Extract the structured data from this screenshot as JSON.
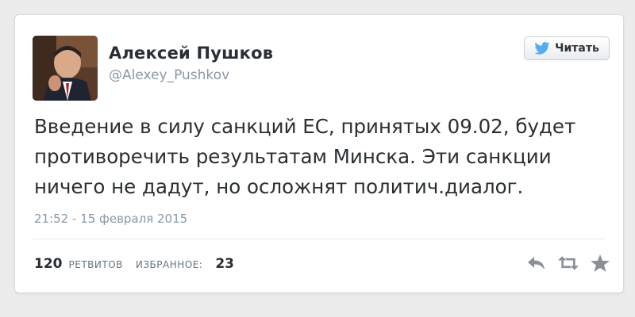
{
  "tweet": {
    "author_name": "Алексей  Пушков",
    "author_handle": "@Alexey_Pushkov",
    "follow_label": "Читать",
    "text": "Введение в силу санкций ЕС, принятых 09.02, будет\nпротиворечить результатам Минска. Эти санкции\nничего не дадут, но осложнят политич.диалог.",
    "timestamp": "21:52 - 15 февраля 2015",
    "retweets_count": "120",
    "retweets_label": "РЕТВИТОВ",
    "favorites_label": "ИЗБРАННОЕ:",
    "favorites_count": "23"
  },
  "icons": {
    "follow": "twitter-bird-icon",
    "reply": "reply-icon",
    "retweet": "retweet-icon",
    "favorite": "star-icon"
  },
  "colors": {
    "text": "#292f33",
    "muted": "#8899a6",
    "twitter_blue": "#55acee",
    "action_gray": "#8a8f94"
  }
}
